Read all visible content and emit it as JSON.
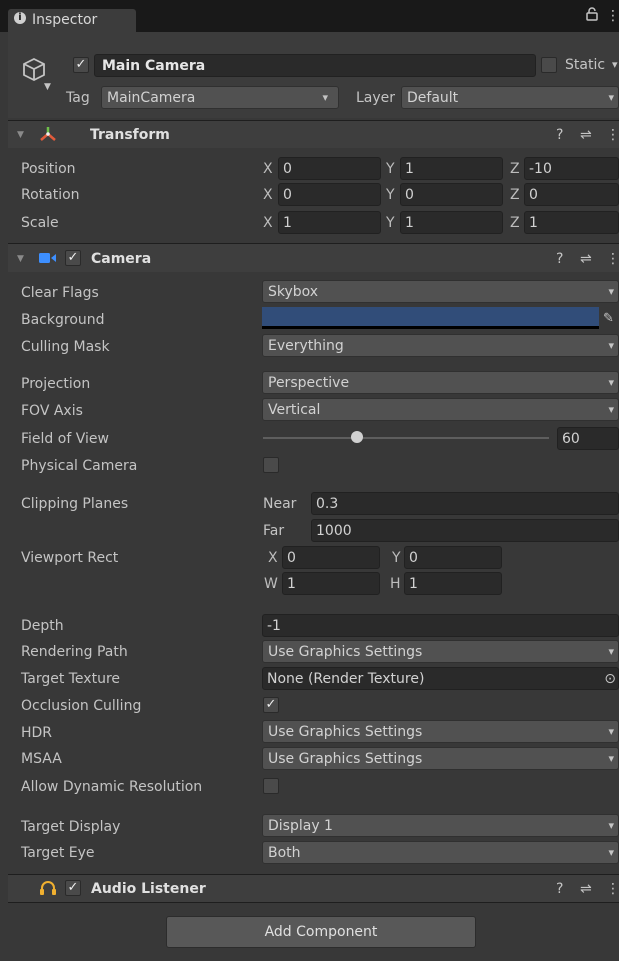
{
  "tab": {
    "icon": "info-icon",
    "title": "Inspector",
    "lock_icon": "lock-icon",
    "menu_icon": "more-vertical-icon"
  },
  "object": {
    "icon": "gameobject-cube-icon",
    "active": true,
    "name": "Main Camera",
    "static_label": "Static",
    "static_checked": false,
    "tag_label": "Tag",
    "tag_value": "MainCamera",
    "layer_label": "Layer",
    "layer_value": "Default"
  },
  "transform": {
    "title": "Transform",
    "icon": "transform-axes-icon",
    "rows": [
      {
        "label": "Position",
        "x": "0",
        "y": "1",
        "z": "-10"
      },
      {
        "label": "Rotation",
        "x": "0",
        "y": "0",
        "z": "0"
      },
      {
        "label": "Scale",
        "x": "1",
        "y": "1",
        "z": "1"
      }
    ],
    "axis_labels": {
      "x": "X",
      "y": "Y",
      "z": "Z"
    }
  },
  "camera": {
    "title": "Camera",
    "icon": "camera-icon",
    "enabled": true,
    "clear_flags": {
      "label": "Clear Flags",
      "value": "Skybox"
    },
    "background": {
      "label": "Background",
      "color": "#314d79"
    },
    "culling_mask": {
      "label": "Culling Mask",
      "value": "Everything"
    },
    "projection": {
      "label": "Projection",
      "value": "Perspective"
    },
    "fov_axis": {
      "label": "FOV Axis",
      "value": "Vertical"
    },
    "field_of_view": {
      "label": "Field of View",
      "value": "60",
      "slider_fraction": 0.33
    },
    "physical_camera": {
      "label": "Physical Camera",
      "checked": false
    },
    "clipping_planes": {
      "label": "Clipping Planes",
      "near_label": "Near",
      "near": "0.3",
      "far_label": "Far",
      "far": "1000"
    },
    "viewport_rect": {
      "label": "Viewport Rect",
      "x_label": "X",
      "x": "0",
      "y_label": "Y",
      "y": "0",
      "w_label": "W",
      "w": "1",
      "h_label": "H",
      "h": "1"
    },
    "depth": {
      "label": "Depth",
      "value": "-1"
    },
    "rendering_path": {
      "label": "Rendering Path",
      "value": "Use Graphics Settings"
    },
    "target_texture": {
      "label": "Target Texture",
      "value": "None (Render Texture)"
    },
    "occlusion_culling": {
      "label": "Occlusion Culling",
      "checked": true
    },
    "hdr": {
      "label": "HDR",
      "value": "Use Graphics Settings"
    },
    "msaa": {
      "label": "MSAA",
      "value": "Use Graphics Settings"
    },
    "allow_dynamic_resolution": {
      "label": "Allow Dynamic Resolution",
      "checked": false
    },
    "target_display": {
      "label": "Target Display",
      "value": "Display 1"
    },
    "target_eye": {
      "label": "Target Eye",
      "value": "Both"
    }
  },
  "audio_listener": {
    "title": "Audio Listener",
    "icon": "headphones-icon",
    "enabled": true
  },
  "add_component": "Add Component",
  "glyphs": {
    "check": "✓",
    "dropdown": "▾",
    "foldout": "▼",
    "help": "?",
    "settings": "⇌",
    "menu": "⋮",
    "picker": "⊙",
    "eyedropper": "✎"
  },
  "colors": {
    "background": "#383838",
    "field": "#2a2a2a",
    "dropdown": "#515151",
    "accent_camera": "#3d8fff",
    "headphones": "#f0b030"
  }
}
